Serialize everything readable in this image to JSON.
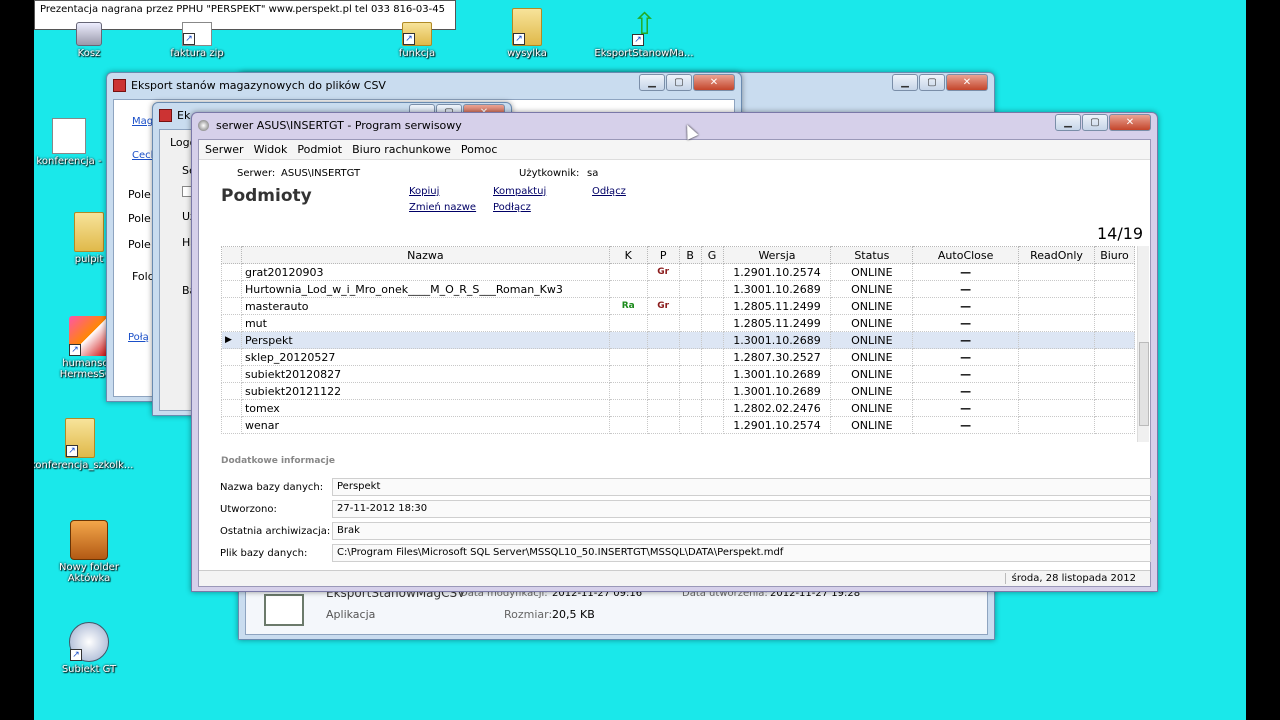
{
  "note": "Prezentacja nagrana przez PPHU \"PERSPEKT\" www.perspekt.pl    tel 033 816-03-45",
  "desktop_icons": [
    {
      "label": "Kosz",
      "icon": "recycle-bin-icon"
    },
    {
      "label": "faktura zip",
      "icon": "archive-icon"
    },
    {
      "label": "funkcja",
      "icon": "folder-icon"
    },
    {
      "label": "wysylka",
      "icon": "folder-icon"
    },
    {
      "label": "EksportStanowMa...",
      "icon": "arrow-app-icon"
    },
    {
      "label": "konferencja -",
      "icon": "document-icon"
    },
    {
      "label": "pulpit",
      "icon": "folder-icon"
    },
    {
      "label": "humansoft HermesSQL",
      "icon": "app-icon"
    },
    {
      "label": "konferencja_szkolk...",
      "icon": "folder-icon"
    },
    {
      "label": "Nowy folder Aktówka",
      "icon": "briefcase-icon"
    },
    {
      "label": "Subiekt GT",
      "icon": "subiekt-icon"
    }
  ],
  "back_window": {
    "title": "Eksport stanów magazynowych do plików CSV",
    "links": [
      "Mag",
      "Cecl",
      "Połą"
    ],
    "field_labels": [
      "Pole",
      "Pole",
      "Pole",
      "Folde"
    ]
  },
  "mid_window": {
    "title": "Ek",
    "labels": [
      "Logo",
      "Se",
      "Uż",
      "Ha",
      "Ba"
    ]
  },
  "info_window": {
    "name": "EksportStanowMagCSV",
    "type": "Aplikacja",
    "modified_label": "Data modyfikacji:",
    "modified": "2012-11-27 09:16",
    "created_label": "Data utworzenia:",
    "created": "2012-11-27 19:28",
    "size_label": "Rozmiar:",
    "size": "20,5 KB"
  },
  "main": {
    "title": "serwer ASUS\\INSERTGT - Program serwisowy",
    "menu": [
      "Serwer",
      "Widok",
      "Podmiot",
      "Biuro rachunkowe",
      "Pomoc"
    ],
    "server_label": "Serwer:",
    "server": "ASUS\\INSERTGT",
    "user_label": "Użytkownik:",
    "user": "sa",
    "heading": "Podmioty",
    "actions": [
      "Kopiuj",
      "Zmień nazwe",
      "Kompaktuj",
      "Podłącz",
      "Odłącz"
    ],
    "counter": "14/19",
    "columns": [
      "Nazwa",
      "K",
      "P",
      "B",
      "G",
      "Wersja",
      "Status",
      "AutoClose",
      "ReadOnly",
      "Biuro"
    ],
    "rows": [
      {
        "name": "grat20120903",
        "k": "",
        "p": "Gr",
        "ver": "1.2901.10.2574",
        "status": "ONLINE",
        "ac": "—"
      },
      {
        "name": "Hurtownia_Lod_w_i_Mro_onek____M_O_R_S___Roman_Kw3",
        "k": "",
        "p": "",
        "ver": "1.3001.10.2689",
        "status": "ONLINE",
        "ac": "—"
      },
      {
        "name": "masterauto",
        "k": "Ra",
        "p": "Gr",
        "ver": "1.2805.11.2499",
        "status": "ONLINE",
        "ac": "—"
      },
      {
        "name": "mut",
        "k": "",
        "p": "",
        "ver": "1.2805.11.2499",
        "status": "ONLINE",
        "ac": "—"
      },
      {
        "name": "Perspekt",
        "k": "",
        "p": "",
        "ver": "1.3001.10.2689",
        "status": "ONLINE",
        "ac": "—"
      },
      {
        "name": "sklep_20120527",
        "k": "",
        "p": "",
        "ver": "1.2807.30.2527",
        "status": "ONLINE",
        "ac": "—"
      },
      {
        "name": "subiekt20120827",
        "k": "",
        "p": "",
        "ver": "1.3001.10.2689",
        "status": "ONLINE",
        "ac": "—"
      },
      {
        "name": "subiekt20121122",
        "k": "",
        "p": "",
        "ver": "1.3001.10.2689",
        "status": "ONLINE",
        "ac": "—"
      },
      {
        "name": "tomex",
        "k": "",
        "p": "",
        "ver": "1.2802.02.2476",
        "status": "ONLINE",
        "ac": "—"
      },
      {
        "name": "wenar",
        "k": "",
        "p": "",
        "ver": "1.2901.10.2574",
        "status": "ONLINE",
        "ac": "—"
      }
    ],
    "details_heading": "Dodatkowe informacje",
    "details": [
      {
        "label": "Nazwa bazy danych:",
        "value": "Perspekt"
      },
      {
        "label": "Utworzono:",
        "value": "27-11-2012 18:30"
      },
      {
        "label": "Ostatnia archiwizacja:",
        "value": "Brak"
      },
      {
        "label": "Plik bazy danych:",
        "value": "C:\\Program Files\\Microsoft SQL Server\\MSSQL10_50.INSERTGT\\MSSQL\\DATA\\Perspekt.mdf"
      }
    ],
    "status_date": "środa, 28 listopada 2012"
  }
}
